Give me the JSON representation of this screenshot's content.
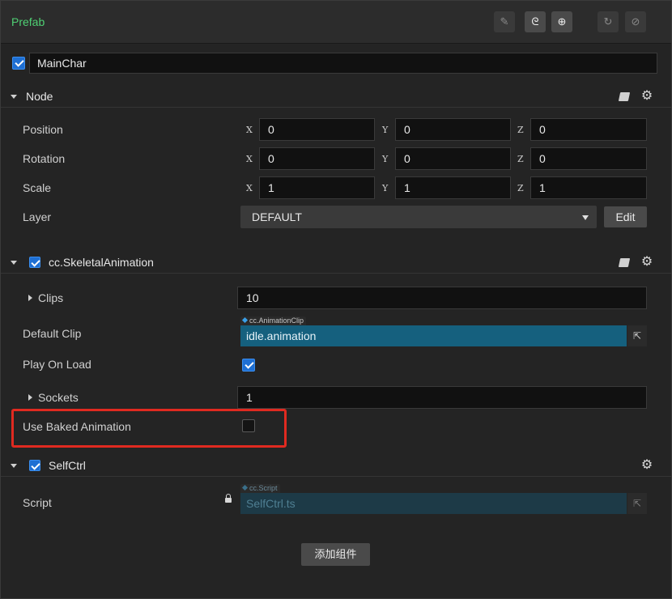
{
  "header": {
    "title": "Prefab",
    "buttons": [
      {
        "name": "edit-icon",
        "glyph": "✎"
      },
      {
        "name": "unlink-icon",
        "glyph": "ᘓ"
      },
      {
        "name": "locate-icon",
        "glyph": "⊕"
      },
      {
        "name": "revert-icon",
        "glyph": "↻"
      },
      {
        "name": "apply-icon",
        "glyph": "⊘"
      }
    ]
  },
  "node_name": "MainChar",
  "node_section": {
    "title": "Node",
    "position": {
      "label": "Position",
      "x": "0",
      "y": "0",
      "z": "0"
    },
    "rotation": {
      "label": "Rotation",
      "x": "0",
      "y": "0",
      "z": "0"
    },
    "scale": {
      "label": "Scale",
      "x": "1",
      "y": "1",
      "z": "1"
    },
    "layer": {
      "label": "Layer",
      "value": "DEFAULT",
      "edit_label": "Edit"
    },
    "axes": {
      "x": "X",
      "y": "Y",
      "z": "Z"
    }
  },
  "skeletal": {
    "title": "cc.SkeletalAnimation",
    "clips": {
      "label": "Clips",
      "value": "10"
    },
    "default_clip": {
      "label": "Default Clip",
      "type": "cc.AnimationClip",
      "value": "idle.animation"
    },
    "play_on_load": {
      "label": "Play On Load",
      "checked": true
    },
    "sockets": {
      "label": "Sockets",
      "value": "1"
    },
    "use_baked": {
      "label": "Use Baked Animation",
      "checked": false
    }
  },
  "selfctrl": {
    "title": "SelfCtrl",
    "script": {
      "label": "Script",
      "type": "cc.Script",
      "value": "SelfCtrl.ts"
    }
  },
  "add_component_label": "添加组件",
  "colors": {
    "accent": "#1e6fd3",
    "prefab_green": "#4fd073",
    "asset_blue": "#15607e",
    "highlight_red": "#e02a20"
  }
}
